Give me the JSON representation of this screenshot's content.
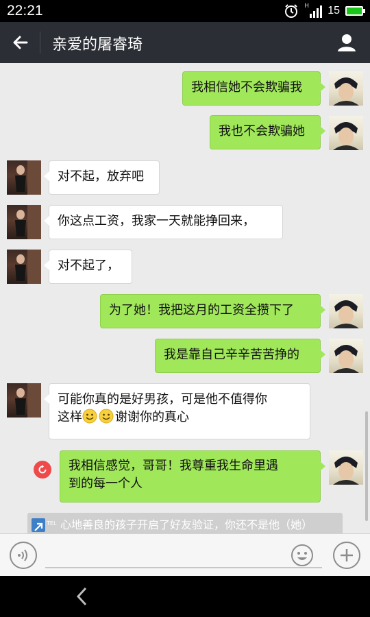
{
  "status_bar": {
    "time": "22:21",
    "network_type": "H",
    "battery_level": "15"
  },
  "header": {
    "title": "亲爱的屠睿琦",
    "back_icon": "arrow-left-icon",
    "profile_icon": "person-icon"
  },
  "messages": [
    {
      "sender": "me",
      "text": "我相信她不会欺骗我"
    },
    {
      "sender": "me",
      "text": "我也不会欺骗她"
    },
    {
      "sender": "other",
      "text": "对不起，放弃吧"
    },
    {
      "sender": "other",
      "text": "你这点工资，我家一天就能挣回来，"
    },
    {
      "sender": "other",
      "text": "对不起了，"
    },
    {
      "sender": "me",
      "text": "为了她！我把这月的工资全攒下了"
    },
    {
      "sender": "me",
      "text": "我是靠自己辛辛苦苦挣的"
    },
    {
      "sender": "other",
      "line1": "可能你真的是好男孩，可是他不值得你",
      "line2_prefix": "这样",
      "line2_suffix": "谢谢你的真心",
      "emoji_icon": "smile-emoji-icon"
    },
    {
      "sender": "me",
      "line1": "我相信感觉，哥哥！我尊重我生命里遇",
      "line2": "到的每一个人",
      "status_icon": "resend-icon"
    }
  ],
  "notice": {
    "text": "心地善良的孩子开启了好友验证，你还不是他（她）",
    "tag": "TEL"
  },
  "input_bar": {
    "placeholder": "",
    "voice_icon": "voice-icon",
    "emoji_icon": "emoji-icon",
    "plus_icon": "plus-icon"
  },
  "nav_bar": {
    "back_icon": "chevron-left-icon"
  },
  "colors": {
    "header_bg": "#2b2e34",
    "chat_bg": "#ebebeb",
    "my_bubble": "#a0e75a",
    "other_bubble": "#ffffff",
    "error_red": "#ef4a4a"
  }
}
